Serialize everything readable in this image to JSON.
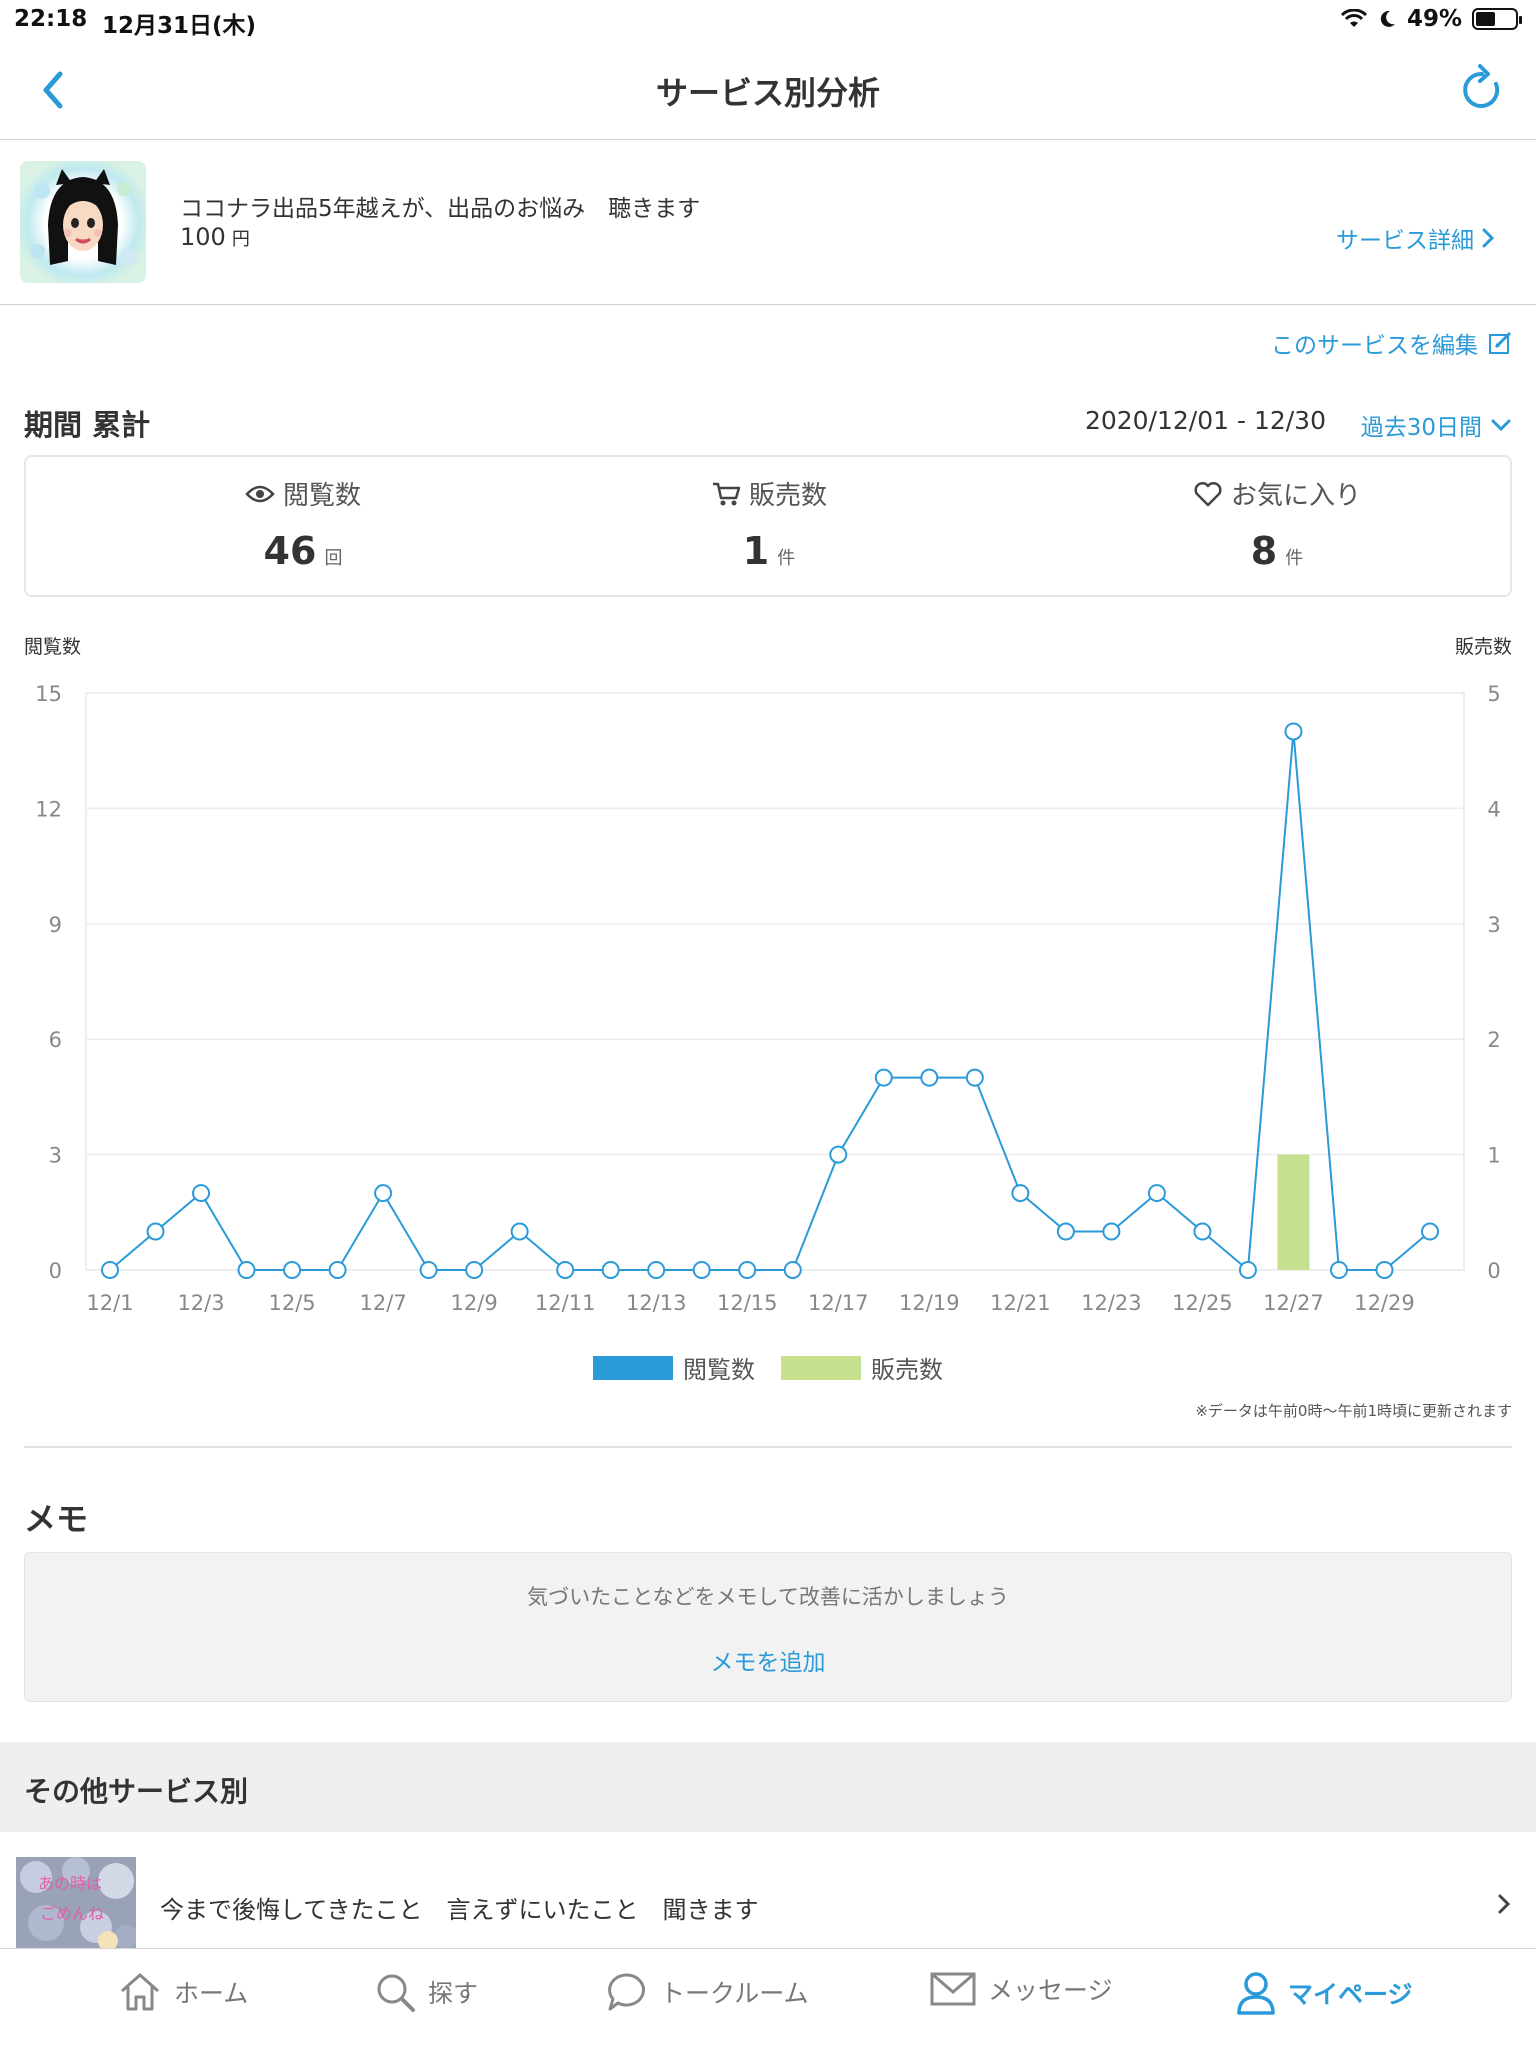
{
  "status_bar": {
    "time": "22:18",
    "date": "12月31日(木)",
    "battery": "49%"
  },
  "nav": {
    "title": "サービス別分析",
    "back_icon": "chevron-left-icon",
    "reload_icon": "reload-icon"
  },
  "service": {
    "title": "ココナラ出品5年越えが、出品のお悩み　聴きます",
    "price": "100",
    "price_unit": "円",
    "detail_link": "サービス詳細"
  },
  "edit_link": "このサービスを編集",
  "period": {
    "title": "期間 累計",
    "range": "2020/12/01 - 12/30",
    "select": "過去30日間"
  },
  "stats": [
    {
      "label": "閲覧数",
      "icon": "eye-icon",
      "value": "46",
      "unit": "回"
    },
    {
      "label": "販売数",
      "icon": "cart-icon",
      "value": "1",
      "unit": "件"
    },
    {
      "label": "お気に入り",
      "icon": "heart-icon",
      "value": "8",
      "unit": "件"
    }
  ],
  "chart_data": {
    "type": "line",
    "ylabel_left": "閲覧数",
    "ylabel_right": "販売数",
    "x": [
      "12/1",
      "12/2",
      "12/3",
      "12/4",
      "12/5",
      "12/6",
      "12/7",
      "12/8",
      "12/9",
      "12/10",
      "12/11",
      "12/12",
      "12/13",
      "12/14",
      "12/15",
      "12/16",
      "12/17",
      "12/18",
      "12/19",
      "12/20",
      "12/21",
      "12/22",
      "12/23",
      "12/24",
      "12/25",
      "12/26",
      "12/27",
      "12/28",
      "12/29",
      "12/30"
    ],
    "x_tick_labels": [
      "12/1",
      "12/3",
      "12/5",
      "12/7",
      "12/9",
      "12/11",
      "12/13",
      "12/15",
      "12/17",
      "12/19",
      "12/21",
      "12/23",
      "12/25",
      "12/27",
      "12/29"
    ],
    "ylim_left": [
      0,
      15
    ],
    "yticks_left": [
      "0",
      "3",
      "6",
      "9",
      "12",
      "15"
    ],
    "ylim_right": [
      0,
      5
    ],
    "yticks_right": [
      "0",
      "1",
      "2",
      "3",
      "4",
      "5"
    ],
    "series": [
      {
        "name": "閲覧数",
        "type": "line",
        "axis": "left",
        "color": "#2b9ad9",
        "values": [
          0,
          1,
          2,
          0,
          0,
          0,
          2,
          0,
          0,
          1,
          0,
          0,
          0,
          0,
          0,
          0,
          3,
          5,
          5,
          5,
          2,
          1,
          1,
          2,
          1,
          0,
          14,
          0,
          0,
          1
        ]
      },
      {
        "name": "販売数",
        "type": "bar",
        "axis": "right",
        "color": "#c5e08e",
        "values": [
          0,
          0,
          0,
          0,
          0,
          0,
          0,
          0,
          0,
          0,
          0,
          0,
          0,
          0,
          0,
          0,
          0,
          0,
          0,
          0,
          0,
          0,
          0,
          0,
          0,
          0,
          1,
          0,
          0,
          0
        ]
      }
    ],
    "grid": true,
    "legend_position": "bottom"
  },
  "note": "※データは午前0時〜午前1時頃に更新されます",
  "memo": {
    "title": "メモ",
    "hint": "気づいたことなどをメモして改善に活かしましょう",
    "add": "メモを追加"
  },
  "other": {
    "title": "その他サービス別",
    "row_title": "今まで後悔してきたこと　言えずにいたこと　聞きます",
    "thumb_text_1": "あの時は",
    "thumb_text_2": "ごめんね"
  },
  "tabs": [
    {
      "label": "ホーム",
      "icon": "home-icon"
    },
    {
      "label": "探す",
      "icon": "search-icon"
    },
    {
      "label": "トークルーム",
      "icon": "chat-bubble-icon"
    },
    {
      "label": "メッセージ",
      "icon": "mail-icon"
    },
    {
      "label": "マイページ",
      "icon": "user-icon"
    }
  ],
  "colors": {
    "accent": "#2b9ad9",
    "views": "#2b9ad9",
    "sales": "#c5e08e"
  }
}
